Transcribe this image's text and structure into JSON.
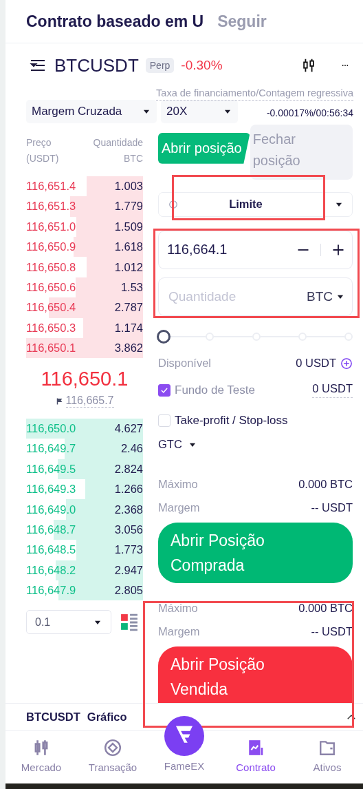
{
  "header_tabs": [
    {
      "label": "Contrato baseado em U",
      "selected": true
    },
    {
      "label": "Seguir",
      "selected": false
    }
  ],
  "symbol": {
    "name": "BTCUSDT",
    "badge": "Perp",
    "change": "-0.30%"
  },
  "margin_mode": {
    "value": "Margem Cruzada"
  },
  "leverage": {
    "value": "20X"
  },
  "funding": {
    "label": "Taxa de financiamento/Contagem regressiva",
    "value": "-0.00017%/00:56:34"
  },
  "order_book": {
    "columns": [
      {
        "label": "Preço",
        "unit": "(USDT)"
      },
      {
        "label": "Quantidade",
        "unit": "BTC"
      }
    ],
    "asks": [
      {
        "price": "116,651.4",
        "amount": "1.003"
      },
      {
        "price": "116,651.3",
        "amount": "1.779"
      },
      {
        "price": "116,651.0",
        "amount": "1.509"
      },
      {
        "price": "116,650.9",
        "amount": "1.618"
      },
      {
        "price": "116,650.8",
        "amount": "1.012"
      },
      {
        "price": "116,650.6",
        "amount": "1.53"
      },
      {
        "price": "116,650.4",
        "amount": "2.787"
      },
      {
        "price": "116,650.3",
        "amount": "1.174"
      },
      {
        "price": "116,650.1",
        "amount": "3.862"
      }
    ],
    "last_price": "116,650.1",
    "mark_price": "116,665.7",
    "bids": [
      {
        "price": "116,650.0",
        "amount": "4.627"
      },
      {
        "price": "116,649.7",
        "amount": "2.46"
      },
      {
        "price": "116,649.5",
        "amount": "2.824"
      },
      {
        "price": "116,649.3",
        "amount": "1.266"
      },
      {
        "price": "116,649.0",
        "amount": "2.368"
      },
      {
        "price": "116,648.7",
        "amount": "3.056"
      },
      {
        "price": "116,648.5",
        "amount": "1.773"
      },
      {
        "price": "116,648.2",
        "amount": "2.947"
      },
      {
        "price": "116,647.9",
        "amount": "2.805"
      }
    ],
    "precision": "0.1"
  },
  "order_form": {
    "tabs": [
      {
        "label": "Abrir posição",
        "selected": true
      },
      {
        "label": "Fechar posição",
        "selected": false
      }
    ],
    "order_type": {
      "value": "Limite",
      "highlighted": true
    },
    "inputs_highlighted": true,
    "price": {
      "value": "116,664.1"
    },
    "quantity": {
      "placeholder": "Quantidade",
      "unit": "BTC"
    },
    "slider": {
      "level": 0
    },
    "available": {
      "label": "Disponível",
      "value": "0 USDT"
    },
    "options": [
      {
        "label": "Fundo de Teste",
        "checked": true,
        "value": "0 USDT"
      },
      {
        "label": "Take-profit / Stop-loss",
        "checked": false
      }
    ],
    "time_in_force": "GTC",
    "sides": [
      {
        "kind": "buy",
        "max_label": "Máximo",
        "max_value": "0.000 BTC",
        "margin_label": "Margem",
        "margin_value": "-- USDT",
        "button": "Abrir Posição Comprada",
        "highlighted": false
      },
      {
        "kind": "sell",
        "max_label": "Máximo",
        "max_value": "0.000 BTC",
        "margin_label": "Margem",
        "margin_value": "-- USDT",
        "button": "Abrir Posição Vendida",
        "highlighted": true
      }
    ]
  },
  "chart_bar": {
    "symbol": "BTCUSDT",
    "label": "Gráfico"
  },
  "nav": [
    {
      "kind": "market",
      "label": "Mercado",
      "selected": false
    },
    {
      "kind": "trade",
      "label": "Transação",
      "selected": false
    },
    {
      "kind": "home",
      "label": "FameEX",
      "selected": false
    },
    {
      "kind": "contract",
      "label": "Contrato",
      "selected": true
    },
    {
      "kind": "assets",
      "label": "Ativos",
      "selected": false
    }
  ]
}
